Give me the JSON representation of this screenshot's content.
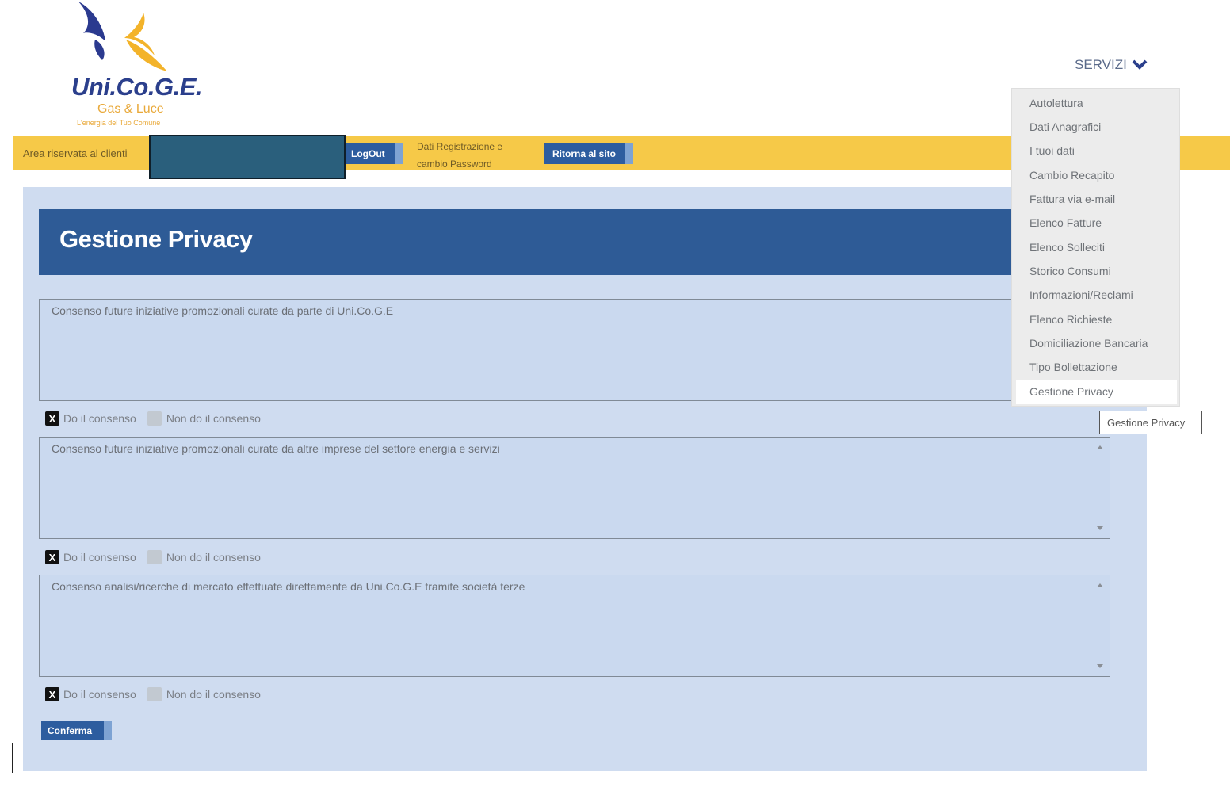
{
  "logo": {
    "title": "Uni.Co.G.E.",
    "subtitle": "Gas & Luce",
    "tagline": "L'energia del Tuo Comune"
  },
  "nav": {
    "servizi_label": "SERVIZI"
  },
  "topbar": {
    "area_label": "Area riservata al clienti",
    "logout_label": "LogOut",
    "registration_link_line1": "Dati Registrazione e",
    "registration_link_line2": "cambio Password",
    "return_label": "Ritorna al sito"
  },
  "page": {
    "title": "Gestione Privacy"
  },
  "consents": [
    {
      "text": "Consenso future iniziative promozionali curate da parte di Uni.Co.G.E",
      "give_label": "Do il consenso",
      "deny_label": "Non do il consenso",
      "given": true,
      "given_mark": "X"
    },
    {
      "text": "Consenso future iniziative promozionali curate da altre imprese del settore energia e servizi",
      "give_label": "Do il consenso",
      "deny_label": "Non do il consenso",
      "given": true,
      "given_mark": "X"
    },
    {
      "text": "Consenso analisi/ricerche di mercato effettuate direttamente da Uni.Co.G.E tramite società terze",
      "give_label": "Do il consenso",
      "deny_label": "Non do il consenso",
      "given": true,
      "given_mark": "X"
    }
  ],
  "confirm_label": "Conferma",
  "servizi_menu": {
    "items": [
      "Autolettura",
      "Dati Anagrafici",
      "I tuoi dati",
      "Cambio Recapito",
      "Fattura via e-mail",
      "Elenco Fatture",
      "Elenco Solleciti",
      "Storico Consumi",
      "Informazioni/Reclami",
      "Elenco Richieste",
      "Domiciliazione Bancaria",
      "Tipo Bollettazione",
      "Gestione Privacy"
    ],
    "active_item": "Gestione Privacy"
  },
  "tooltip": {
    "text": "Gestione Privacy"
  },
  "colors": {
    "brand_blue": "#2e5b96",
    "bar_yellow": "#f6c948",
    "panel": "#cfdcf0"
  }
}
